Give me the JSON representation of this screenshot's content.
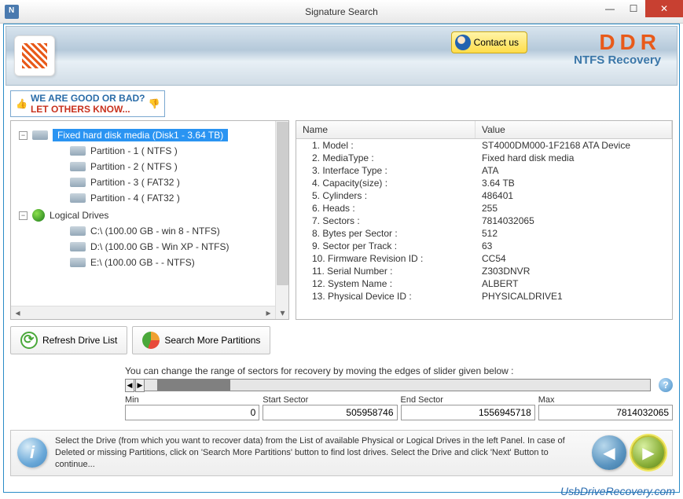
{
  "window": {
    "title": "Signature Search"
  },
  "banner": {
    "contact": "Contact us",
    "brand": "DDR",
    "product": "NTFS Recovery"
  },
  "feedback": {
    "line1": "WE ARE GOOD OR BAD?",
    "line2": "LET OTHERS KNOW..."
  },
  "tree": {
    "root": "Fixed hard disk media (Disk1 - 3.64 TB)",
    "partitions": [
      "Partition - 1 ( NTFS )",
      "Partition - 2 ( NTFS )",
      "Partition - 3 ( FAT32 )",
      "Partition - 4 ( FAT32 )"
    ],
    "logical_header": "Logical Drives",
    "logical": [
      "C:\\ (100.00 GB - win 8 - NTFS)",
      "D:\\ (100.00 GB - Win XP - NTFS)",
      "E:\\ (100.00 GB -  - NTFS)"
    ]
  },
  "buttons": {
    "refresh": "Refresh Drive List",
    "search": "Search More Partitions"
  },
  "grid": {
    "headers": {
      "name": "Name",
      "value": "Value"
    },
    "rows": [
      {
        "n": "1. Model :",
        "v": "ST4000DM000-1F2168 ATA Device"
      },
      {
        "n": "2. MediaType :",
        "v": "Fixed hard disk media"
      },
      {
        "n": "3. Interface Type :",
        "v": "ATA"
      },
      {
        "n": "4. Capacity(size) :",
        "v": "3.64 TB"
      },
      {
        "n": "5. Cylinders :",
        "v": "486401"
      },
      {
        "n": "6. Heads :",
        "v": "255"
      },
      {
        "n": "7. Sectors :",
        "v": "7814032065"
      },
      {
        "n": "8. Bytes per Sector :",
        "v": "512"
      },
      {
        "n": "9. Sector per Track :",
        "v": "63"
      },
      {
        "n": "10. Firmware Revision ID :",
        "v": "CC54"
      },
      {
        "n": "11. Serial Number :",
        "v": "Z303DNVR"
      },
      {
        "n": "12. System Name :",
        "v": "ALBERT"
      },
      {
        "n": "13. Physical Device ID :",
        "v": "PHYSICALDRIVE1"
      }
    ]
  },
  "sector": {
    "hint": "You can change the range of sectors for recovery by moving the edges of slider given below :",
    "min_label": "Min",
    "min": "0",
    "start_label": "Start Sector",
    "start": "505958746",
    "end_label": "End Sector",
    "end": "1556945718",
    "max_label": "Max",
    "max": "7814032065"
  },
  "footer": {
    "text": "Select the Drive (from which you want to recover data) from the List of available Physical or Logical Drives in the left Panel. In case of Deleted or missing Partitions, click on 'Search More Partitions' button to find lost drives. Select the Drive and click 'Next' Button to continue..."
  },
  "watermark": "UsbDriveRecovery.com"
}
